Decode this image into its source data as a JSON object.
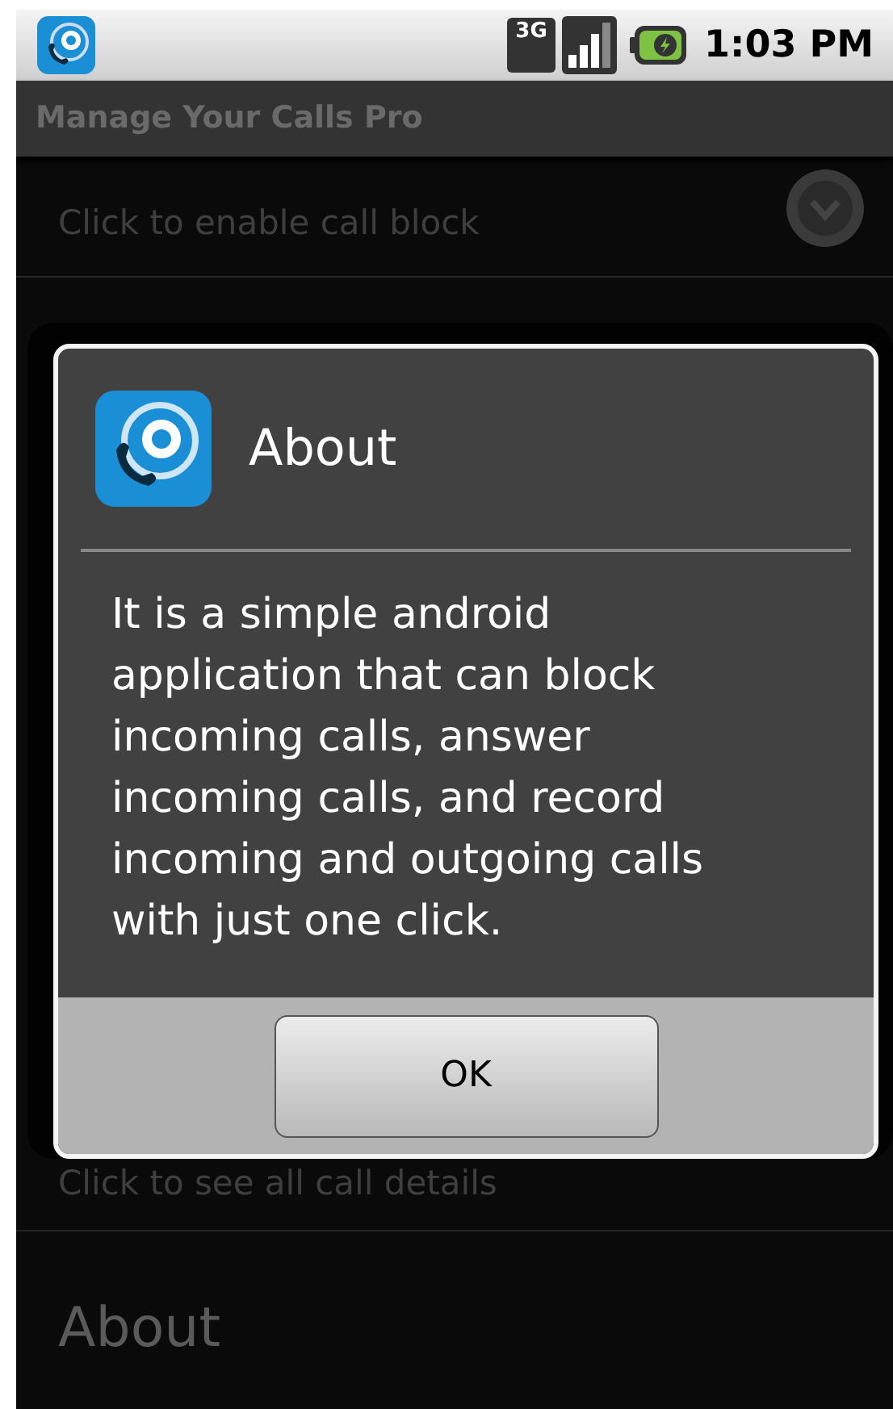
{
  "status_bar": {
    "network": "3G",
    "time": "1:03 PM"
  },
  "app_bar": {
    "title": "Manage Your Calls Pro"
  },
  "settings": [
    {
      "kind": "check",
      "summary": "Click to enable call block",
      "checked": false
    },
    {
      "kind": "plain",
      "summary": "Click to see all call details"
    },
    {
      "kind": "plain",
      "title": "About"
    }
  ],
  "dialog": {
    "title": "About",
    "message": "It is a simple android application that can block incoming calls, answer incoming calls, and record incoming and outgoing calls with just one click.",
    "buttons": [
      "OK"
    ]
  }
}
